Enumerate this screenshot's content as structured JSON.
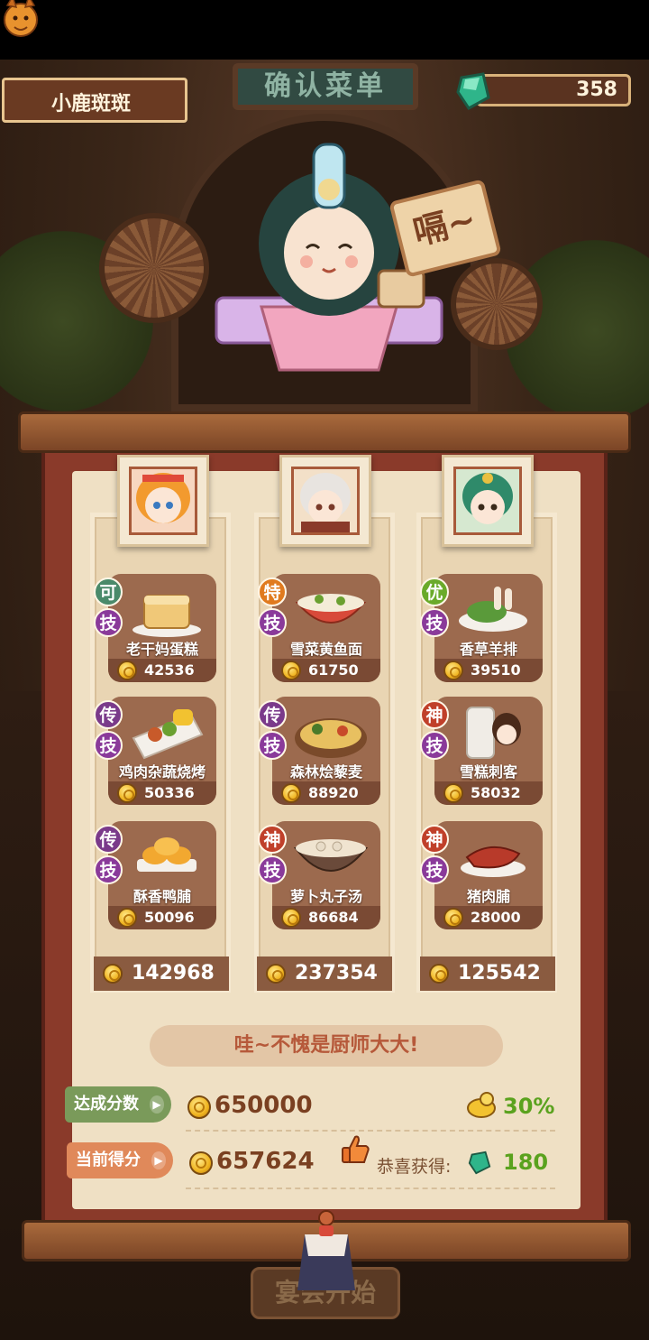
{
  "header": {
    "player_name": "小鹿斑斑",
    "signboard_title": "确认菜单",
    "gem_count": "358"
  },
  "chef_speech": "嗝~",
  "columns": [
    {
      "portrait": "girl-orange-hair-portrait",
      "dishes": [
        {
          "tier": "可",
          "skill": "技",
          "name": "老干妈蛋糕",
          "score": "42536"
        },
        {
          "tier": "传",
          "skill": "技",
          "name": "鸡肉杂蔬烧烤",
          "score": "50336"
        },
        {
          "tier": "传",
          "skill": "技",
          "name": "酥香鸭脯",
          "score": "50096"
        }
      ],
      "total": "142968"
    },
    {
      "portrait": "boy-white-hair-portrait",
      "dishes": [
        {
          "tier": "特",
          "skill": "技",
          "name": "雪菜黄鱼面",
          "score": "61750"
        },
        {
          "tier": "传",
          "skill": "技",
          "name": "森林烩藜麦",
          "score": "88920"
        },
        {
          "tier": "神",
          "skill": "技",
          "name": "萝卜丸子汤",
          "score": "86684"
        }
      ],
      "total": "237354"
    },
    {
      "portrait": "boy-green-hair-portrait",
      "dishes": [
        {
          "tier": "优",
          "skill": "技",
          "name": "香草羊排",
          "score": "39510"
        },
        {
          "tier": "神",
          "skill": "技",
          "name": "雪糕刺客",
          "score": "58032"
        },
        {
          "tier": "神",
          "skill": "技",
          "name": "猪肉脯",
          "score": "28000"
        }
      ],
      "total": "125542"
    }
  ],
  "tier_colors": {
    "可": "#4a8a6a",
    "特": "#e07a1e",
    "优": "#6aaa2a",
    "传": "#7a3a8a",
    "神": "#c0402a"
  },
  "praise_text": "哇~不愧是厨师大大!",
  "summary": {
    "target_label": "达成分数",
    "target_value": "650000",
    "target_bonus": "30%",
    "current_label": "当前得分",
    "current_value": "657624",
    "reward_label": "恭喜获得:",
    "reward_value": "180"
  },
  "start_button": "宴会开始"
}
